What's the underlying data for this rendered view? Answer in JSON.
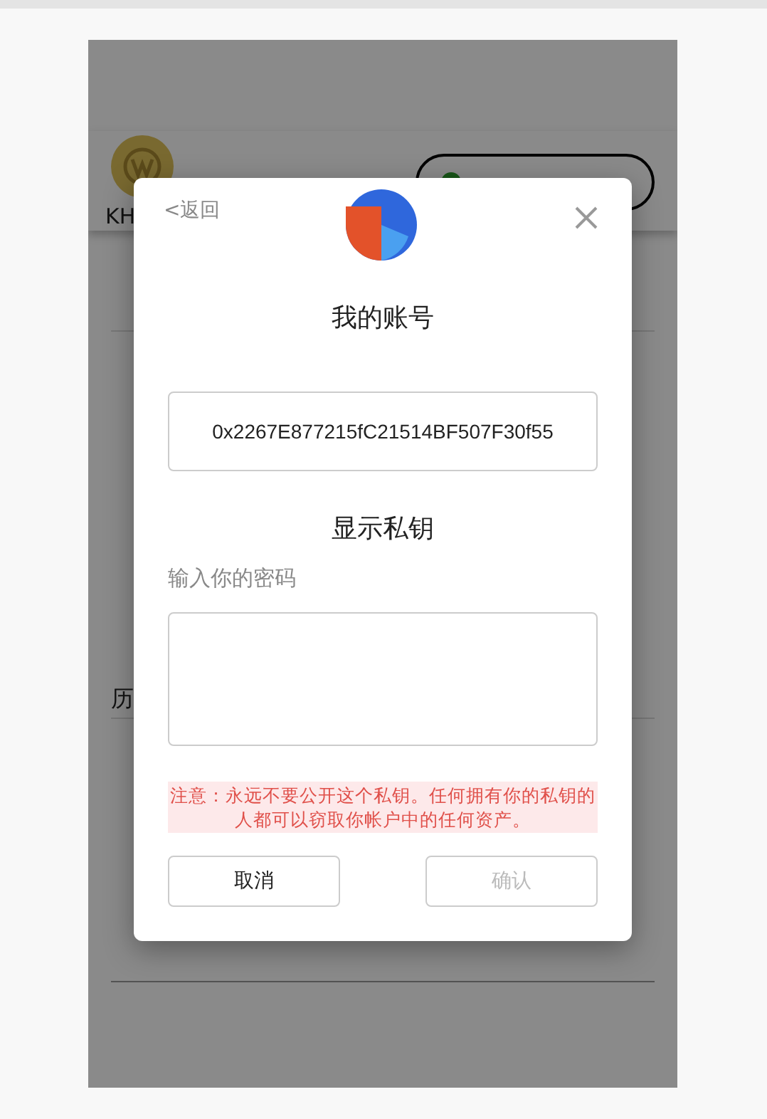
{
  "app": {
    "account_name": "KH",
    "history_label": "历"
  },
  "dialog": {
    "back": "<返回",
    "title": "我的账号",
    "address": "0x2267E877215fC21514BF507F30f55",
    "section_title": "显示私钥",
    "password": {
      "label": "输入你的密码"
    },
    "warning": "注意：永远不要公开这个私钥。任何拥有你的私钥的人都可以窃取你帐户中的任何资产。",
    "buttons": [
      {
        "label": "取消",
        "disabled": false
      },
      {
        "label": "确认",
        "disabled": true
      }
    ]
  }
}
